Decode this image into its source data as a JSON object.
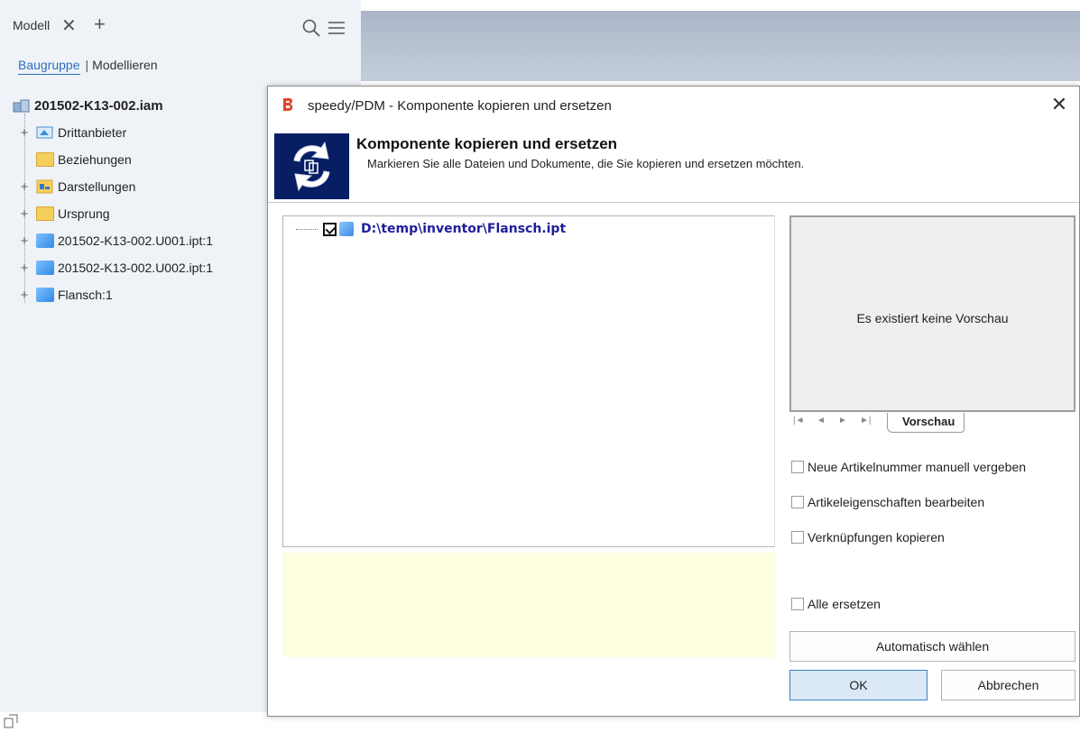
{
  "browser": {
    "tab_label": "Modell",
    "close_glyph": "✕",
    "add_glyph": "+",
    "mode_active": "Baugruppe",
    "mode_separator": "|",
    "mode_inactive": "Modellieren"
  },
  "tree": {
    "root": "201502-K13-002.iam",
    "items": [
      {
        "label": "Drittanbieter",
        "icon": "third-party-icon"
      },
      {
        "label": "Beziehungen",
        "icon": "folder-icon"
      },
      {
        "label": "Darstellungen",
        "icon": "representations-icon"
      },
      {
        "label": "Ursprung",
        "icon": "folder-icon"
      },
      {
        "label": "201502-K13-002.U001.ipt:1",
        "icon": "part-icon"
      },
      {
        "label": "201502-K13-002.U002.ipt:1",
        "icon": "part-icon"
      },
      {
        "label": "Flansch:1",
        "icon": "part-icon"
      }
    ]
  },
  "dialog": {
    "title": "speedy/PDM - Komponente kopieren und ersetzen",
    "close_glyph": "✕",
    "heading": "Komponente kopieren und ersetzen",
    "subtitle": "Markieren Sie alle Dateien und Dokumente, die Sie kopieren und ersetzen möchten.",
    "file_entry": "D:\\temp\\inventor\\Flansch.ipt",
    "preview_empty": "Es existiert keine Vorschau",
    "preview_tab": "Vorschau",
    "nav_glyphs": [
      "|◄",
      "◄",
      "►",
      "►|"
    ],
    "options": [
      "Neue Artikelnummer manuell vergeben",
      "Artikeleigenschaften bearbeiten",
      "Verknüpfungen kopieren",
      "Alle ersetzen"
    ],
    "auto_button": "Automatisch wählen",
    "ok_button": "OK",
    "cancel_button": "Abbrechen"
  },
  "colors": {
    "accent": "#2b6fc0",
    "banner_icon_bg": "#071e64",
    "info_panel_bg": "#fefee0",
    "path_text": "#1d1d9c"
  }
}
